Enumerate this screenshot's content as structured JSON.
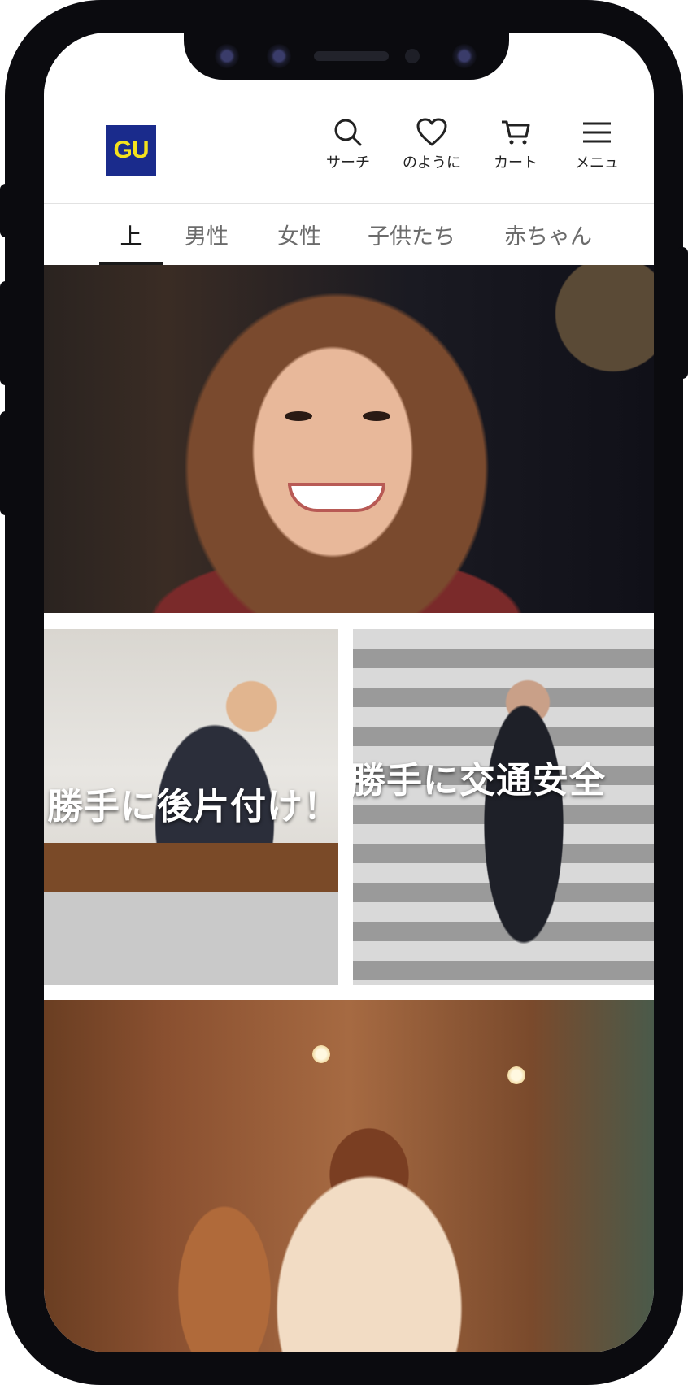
{
  "header": {
    "logo_text": "GU",
    "brand_color": "#1a2b8c",
    "logo_text_color": "#f5e21d",
    "actions": [
      {
        "label": "サーチ",
        "icon": "search-icon"
      },
      {
        "label": "のように",
        "icon": "heart-icon"
      },
      {
        "label": "カート",
        "icon": "cart-icon"
      },
      {
        "label": "メニュ",
        "icon": "menu-icon"
      }
    ]
  },
  "tabs": {
    "items": [
      "上",
      "男性",
      "女性",
      "子供たち",
      "赤ちゃん"
    ],
    "active": "上"
  },
  "banners": {
    "hero": {
      "description_icon": "hero-photo"
    },
    "tile_left": {
      "caption": "勝手に後片付け！"
    },
    "tile_right": {
      "caption": "勝手に交通安全"
    },
    "bottom": {
      "description_icon": "fox-photo"
    }
  }
}
